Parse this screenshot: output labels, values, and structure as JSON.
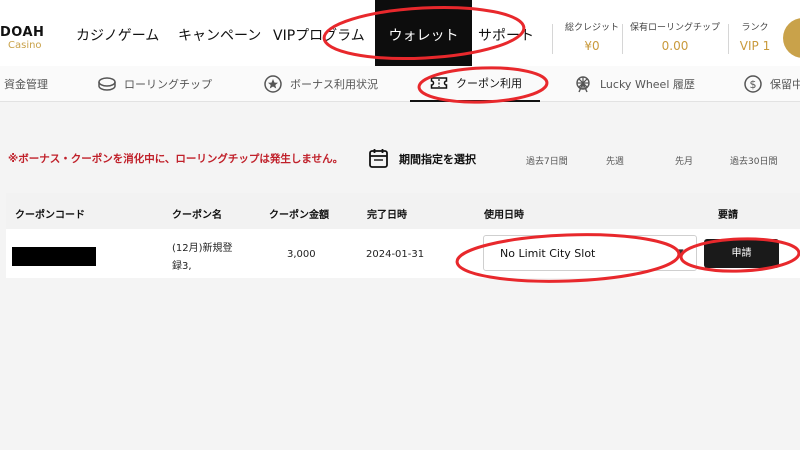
{
  "header": {
    "logo": {
      "main": "DOAH",
      "sub": "Casino"
    },
    "nav": [
      {
        "label": "カジノゲーム"
      },
      {
        "label": "キャンペーン"
      },
      {
        "label": "VIPプログラム"
      },
      {
        "label": "ウォレット",
        "active": true
      },
      {
        "label": "サポート"
      }
    ],
    "stats": [
      {
        "label": "総クレジット",
        "value": "¥0"
      },
      {
        "label": "保有ローリングチップ",
        "value": "0.00"
      },
      {
        "label": "ランク",
        "value": "VIP 1"
      }
    ]
  },
  "subnav": [
    {
      "label": "資金管理",
      "icon": "wallet-icon"
    },
    {
      "label": "ローリングチップ",
      "icon": "chip-icon"
    },
    {
      "label": "ボーナス利用状況",
      "icon": "star-badge-icon"
    },
    {
      "label": "クーポン利用",
      "icon": "ticket-icon",
      "active": true
    },
    {
      "label": "Lucky Wheel 履歴",
      "icon": "ferris-wheel-icon"
    },
    {
      "label": "保留中",
      "icon": "dollar-circle-icon"
    }
  ],
  "notice": "※ボーナス・クーポンを消化中に、ローリングチップは発生しません。",
  "period": {
    "label": "期間指定を選択",
    "filters": [
      "過去7日間",
      "先週",
      "先月",
      "過去30日間"
    ]
  },
  "table": {
    "headers": [
      "クーポンコード",
      "クーポン名",
      "クーポン金額",
      "完了日時",
      "使用日時",
      "要請"
    ],
    "rows": [
      {
        "code": "",
        "name_line1": "(12月)新規登",
        "name_line2": "録3,",
        "amount": "3,000",
        "completed": "2024-01-31",
        "use_select": "No Limit City Slot",
        "action": "申請"
      }
    ]
  },
  "colors": {
    "accent_gold": "#c99a3c",
    "notice_red": "#c0202a",
    "annotation_red": "#e8282c",
    "dark": "#0d0d0d"
  }
}
